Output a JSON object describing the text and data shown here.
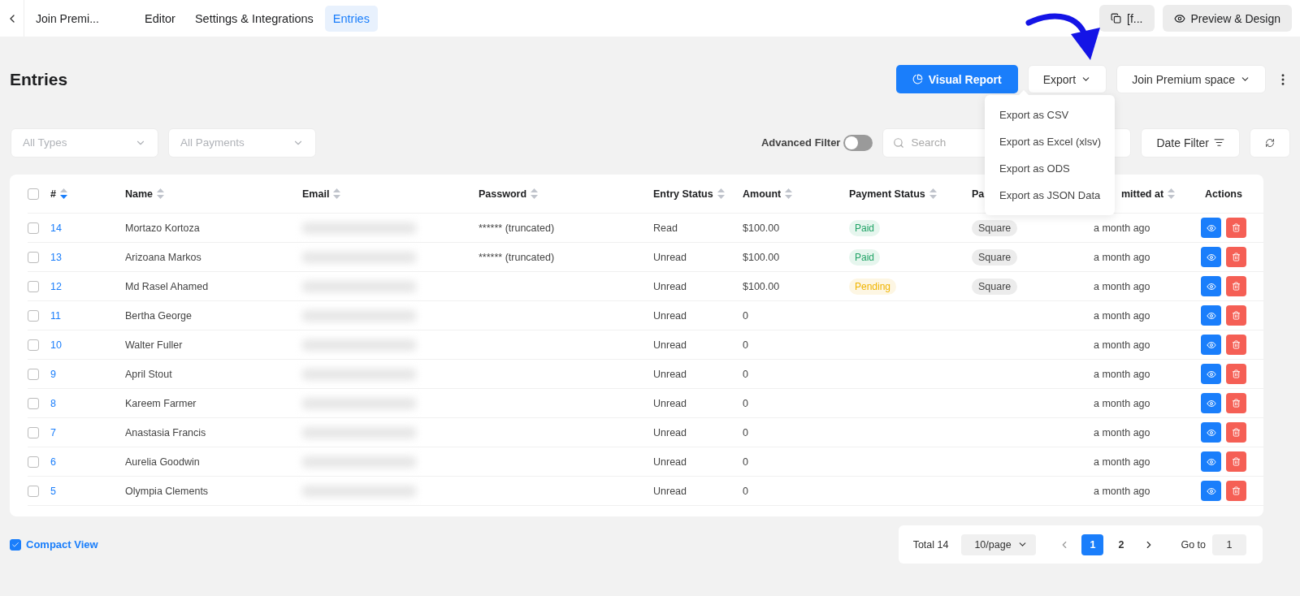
{
  "topbar": {
    "form_title": "Join Premi...",
    "tabs": [
      {
        "label": "Editor",
        "selected": false
      },
      {
        "label": "Settings & Integrations",
        "selected": false
      },
      {
        "label": "Entries",
        "selected": true
      }
    ],
    "shortcode": "[f...",
    "preview": "Preview & Design"
  },
  "page_title": "Entries",
  "actions": {
    "visual_report": "Visual Report",
    "export": "Export",
    "form_select": "Join Premium space"
  },
  "export_menu": [
    "Export as CSV",
    "Export as Excel (xlsv)",
    "Export as ODS",
    "Export as JSON Data"
  ],
  "filters": {
    "types": {
      "placeholder": "All Types"
    },
    "payments": {
      "placeholder": "All Payments"
    },
    "advanced_filter": {
      "label": "Advanced Filter",
      "on": false
    },
    "search": {
      "placeholder": "Search"
    },
    "date_filter": "Date Filter"
  },
  "table": {
    "select_all": {
      "checked": false
    },
    "columns": [
      {
        "label": "#",
        "sorted": true
      },
      {
        "label": "Name",
        "sorted": false
      },
      {
        "label": "Email",
        "sorted": false
      },
      {
        "label": "Password",
        "sorted": false
      },
      {
        "label": "Entry Status",
        "sorted": false
      },
      {
        "label": "Amount",
        "sorted": false
      },
      {
        "label": "Payment Status",
        "sorted": false
      },
      {
        "label": "Pa"
      },
      {
        "label": "mitted at",
        "sorted": false
      },
      {
        "label": "Actions"
      }
    ],
    "rows": [
      {
        "checked": false,
        "id": "14",
        "name": "Mortazo Kortoza",
        "password": "****** (truncated)",
        "entry_status": "Read",
        "amount": "$100.00",
        "payment_status": {
          "label": "Paid",
          "kind": "paid"
        },
        "method": "Square",
        "submitted": "a month ago"
      },
      {
        "checked": false,
        "id": "13",
        "name": "Arizoana Markos",
        "password": "****** (truncated)",
        "entry_status": "Unread",
        "amount": "$100.00",
        "payment_status": {
          "label": "Paid",
          "kind": "paid"
        },
        "method": "Square",
        "submitted": "a month ago"
      },
      {
        "checked": false,
        "id": "12",
        "name": "Md Rasel Ahamed",
        "entry_status": "Unread",
        "amount": "$100.00",
        "payment_status": {
          "label": "Pending",
          "kind": "pending"
        },
        "method": "Square",
        "submitted": "a month ago"
      },
      {
        "checked": false,
        "id": "11",
        "name": "Bertha George",
        "entry_status": "Unread",
        "amount": "0",
        "submitted": "a month ago"
      },
      {
        "checked": false,
        "id": "10",
        "name": "Walter Fuller",
        "entry_status": "Unread",
        "amount": "0",
        "submitted": "a month ago"
      },
      {
        "checked": false,
        "id": "9",
        "name": "April Stout",
        "entry_status": "Unread",
        "amount": "0",
        "submitted": "a month ago"
      },
      {
        "checked": false,
        "id": "8",
        "name": "Kareem Farmer",
        "entry_status": "Unread",
        "amount": "0",
        "submitted": "a month ago"
      },
      {
        "checked": false,
        "id": "7",
        "name": "Anastasia Francis",
        "entry_status": "Unread",
        "amount": "0",
        "submitted": "a month ago"
      },
      {
        "checked": false,
        "id": "6",
        "name": "Aurelia Goodwin",
        "entry_status": "Unread",
        "amount": "0",
        "submitted": "a month ago"
      },
      {
        "checked": false,
        "id": "5",
        "name": "Olympia Clements",
        "entry_status": "Unread",
        "amount": "0",
        "submitted": "a month ago"
      }
    ]
  },
  "compact_view": {
    "label": "Compact View",
    "checked": true
  },
  "pagination": {
    "total": "Total 14",
    "page_size": "10/page",
    "pages": [
      {
        "label": "1",
        "selected": true
      },
      {
        "label": "2",
        "selected": false
      }
    ],
    "goto_label": "Go to",
    "goto_value": "1"
  }
}
